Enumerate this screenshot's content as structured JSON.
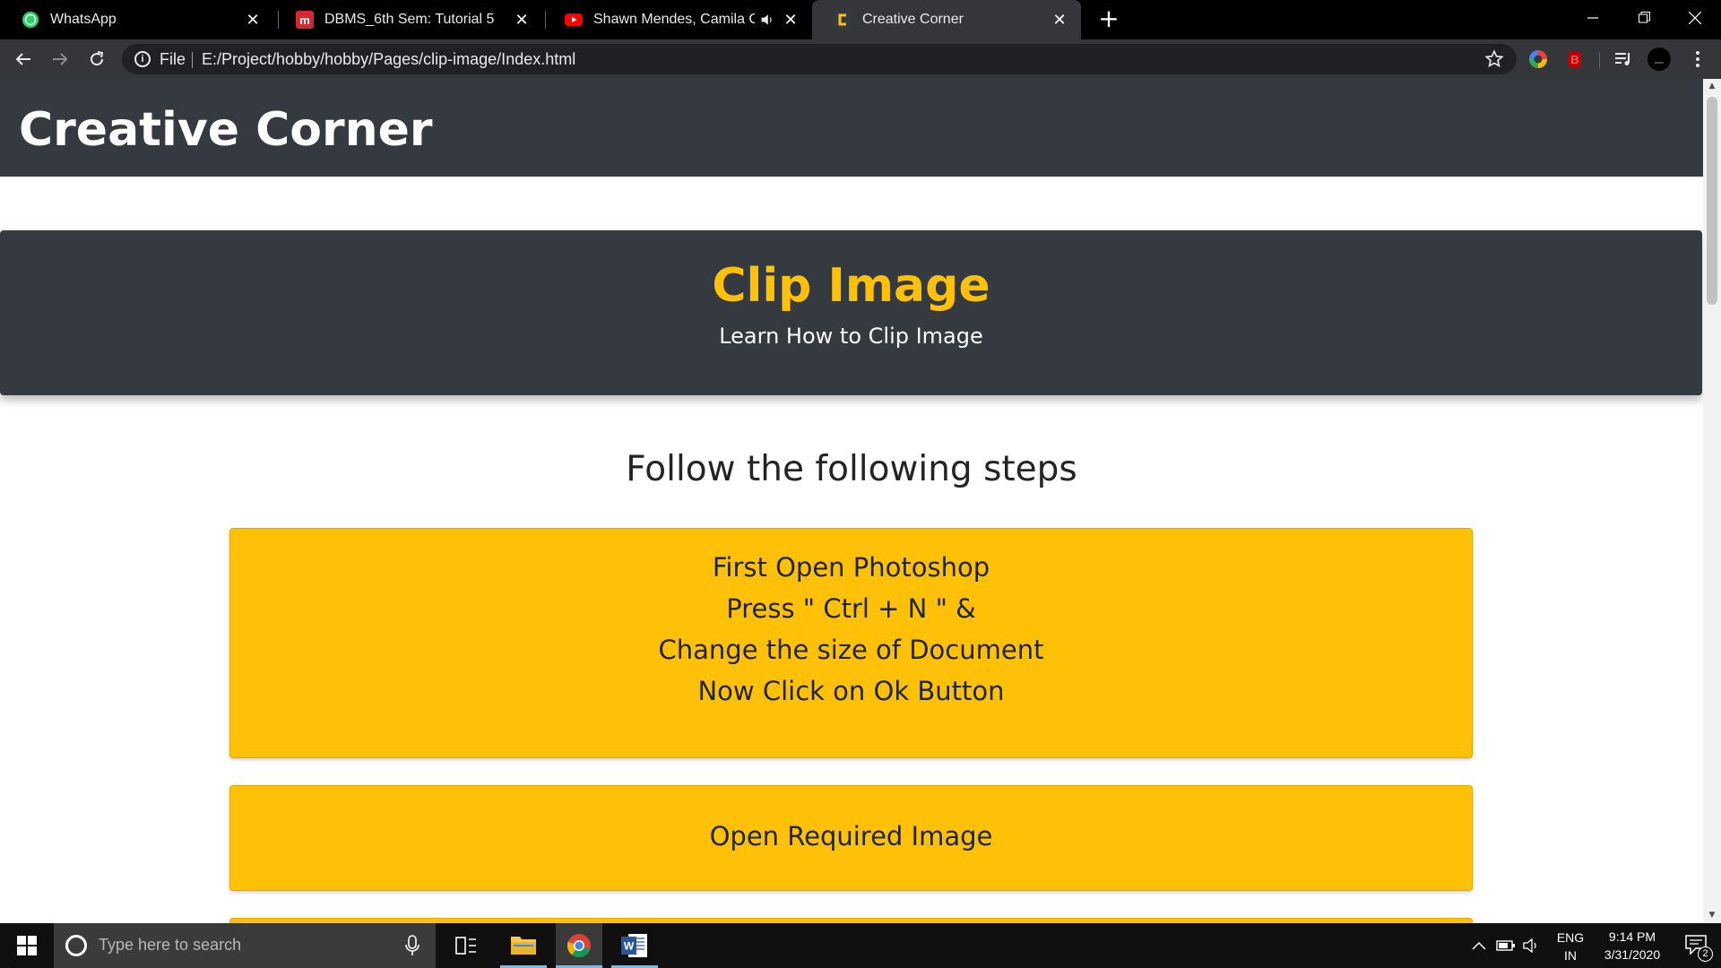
{
  "browser": {
    "tabs": [
      {
        "title": "WhatsApp",
        "icon": "whatsapp-icon",
        "active": false
      },
      {
        "title": "DBMS_6th Sem: Tutorial 5",
        "icon": "moodle-icon",
        "active": false
      },
      {
        "title": "Shawn Mendes, Camila Cabe",
        "icon": "youtube-icon",
        "active": false,
        "audio": true
      },
      {
        "title": "Creative Corner",
        "icon": "creative-corner-icon",
        "active": true
      }
    ],
    "close_glyph": "✕",
    "new_tab_glyph": "+",
    "omnibox": {
      "scheme_label": "File",
      "url": "E:/Project/hobby/hobby/Pages/clip-image/Index.html"
    }
  },
  "page": {
    "site_title": "Creative Corner",
    "hero_title": "Clip Image",
    "hero_subtitle": "Learn How to Clip Image",
    "steps_heading": "Follow the following steps",
    "steps": [
      {
        "lines": [
          "First Open Photoshop",
          "Press \" Ctrl + N \" &",
          "Change the size of Document",
          "Now Click on Ok Button"
        ]
      },
      {
        "lines": [
          "Open Required Image"
        ]
      }
    ]
  },
  "taskbar": {
    "search_placeholder": "Type here to search",
    "language": {
      "line1": "ENG",
      "line2": "IN"
    },
    "time": "9:14 PM",
    "date": "3/31/2020",
    "notification_count": "2"
  },
  "colors": {
    "header_bg": "#343a40",
    "accent_yellow": "#ffc107",
    "tab_strip": "#000000",
    "toolbar": "#35363a"
  }
}
